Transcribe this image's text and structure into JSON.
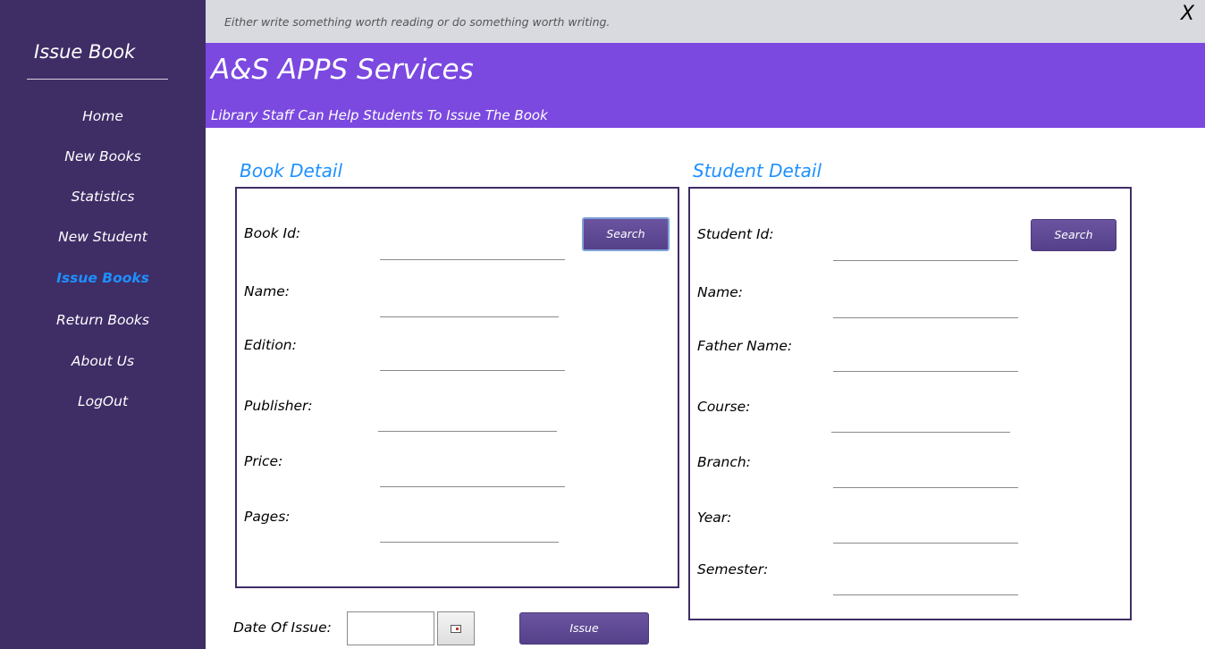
{
  "sidebar": {
    "title": "Issue Book",
    "items": [
      {
        "label": "Home"
      },
      {
        "label": "New Books"
      },
      {
        "label": "Statistics"
      },
      {
        "label": "New Student"
      },
      {
        "label": "Issue Books"
      },
      {
        "label": "Return Books"
      },
      {
        "label": "About Us"
      },
      {
        "label": "LogOut"
      }
    ],
    "active_index": 4
  },
  "top_bar": {
    "quote": "Either write something worth reading or do something worth writing.",
    "close_label": "X"
  },
  "banner": {
    "title": "A&S APPS Services",
    "subtitle": "Library Staff Can Help Students To Issue The Book"
  },
  "book_detail": {
    "title": "Book Detail",
    "search_label": "Search",
    "fields": [
      {
        "label": "Book Id:",
        "value": ""
      },
      {
        "label": "Name:",
        "value": ""
      },
      {
        "label": "Edition:",
        "value": ""
      },
      {
        "label": "Publisher:",
        "value": ""
      },
      {
        "label": "Price:",
        "value": ""
      },
      {
        "label": "Pages:",
        "value": ""
      }
    ]
  },
  "student_detail": {
    "title": "Student Detail",
    "search_label": "Search",
    "fields": [
      {
        "label": "Student Id:",
        "value": ""
      },
      {
        "label": "Name:",
        "value": ""
      },
      {
        "label": "Father Name:",
        "value": ""
      },
      {
        "label": "Course:",
        "value": ""
      },
      {
        "label": "Branch:",
        "value": ""
      },
      {
        "label": "Year:",
        "value": ""
      },
      {
        "label": "Semester:",
        "value": ""
      }
    ]
  },
  "issue": {
    "date_label": "Date Of Issue:",
    "date_value": "",
    "issue_label": "Issue"
  },
  "colors": {
    "sidebar_bg": "#3f2d66",
    "banner_bg": "#7b49e0",
    "accent": "#1e90ff",
    "quote_bar_bg": "#d8dae0"
  }
}
